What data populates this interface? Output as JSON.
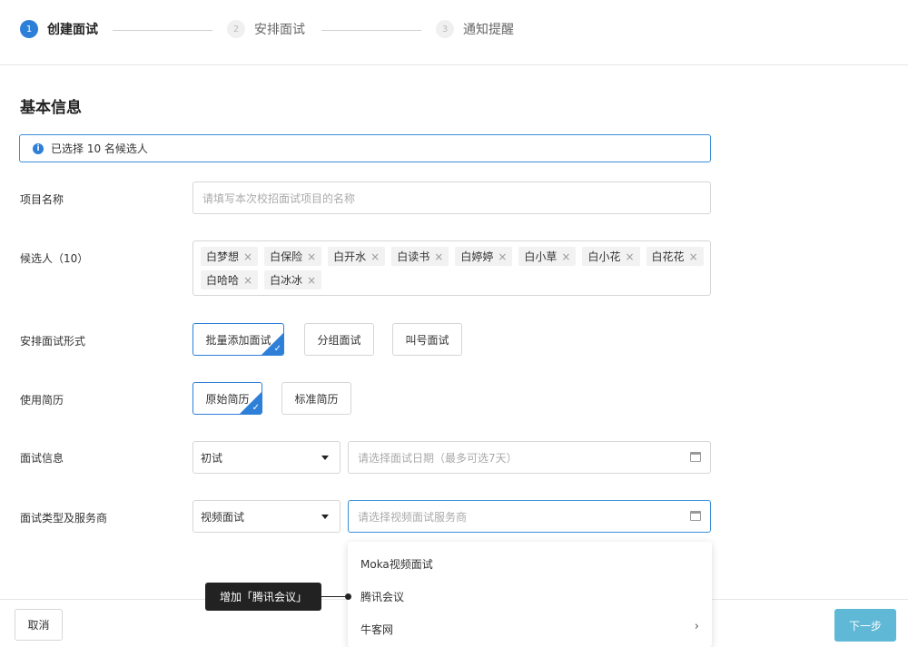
{
  "stepper": {
    "steps": [
      {
        "num": "1",
        "label": "创建面试"
      },
      {
        "num": "2",
        "label": "安排面试"
      },
      {
        "num": "3",
        "label": "通知提醒"
      }
    ]
  },
  "form": {
    "section_title": "基本信息",
    "notice": "已选择 10 名候选人",
    "project_name": {
      "label": "项目名称",
      "placeholder": "请填写本次校招面试项目的名称"
    },
    "candidates": {
      "label": "候选人（10）",
      "tags": [
        "白梦想",
        "白保险",
        "白开水",
        "白读书",
        "白婷婷",
        "白小草",
        "白小花",
        "白花花",
        "白哈哈",
        "白冰冰"
      ]
    },
    "format": {
      "label": "安排面试形式",
      "options": [
        "批量添加面试",
        "分组面试",
        "叫号面试"
      ]
    },
    "resume": {
      "label": "使用简历",
      "options": [
        "原始简历",
        "标准简历"
      ]
    },
    "interview_info": {
      "label": "面试信息",
      "round": "初试",
      "date_placeholder": "请选择面试日期（最多可选7天）"
    },
    "interview_type": {
      "label": "面试类型及服务商",
      "type": "视频面试",
      "provider_placeholder": "请选择视频面试服务商"
    }
  },
  "dropdown": {
    "options": [
      "Moka视频面试",
      "腾讯会议",
      "牛客网"
    ]
  },
  "tooltip": "增加「腾讯会议」",
  "footer": {
    "cancel": "取消",
    "next": "下一步"
  },
  "colors": {
    "accent": "#2d7fd8",
    "next_button": "#5fb8d6"
  }
}
